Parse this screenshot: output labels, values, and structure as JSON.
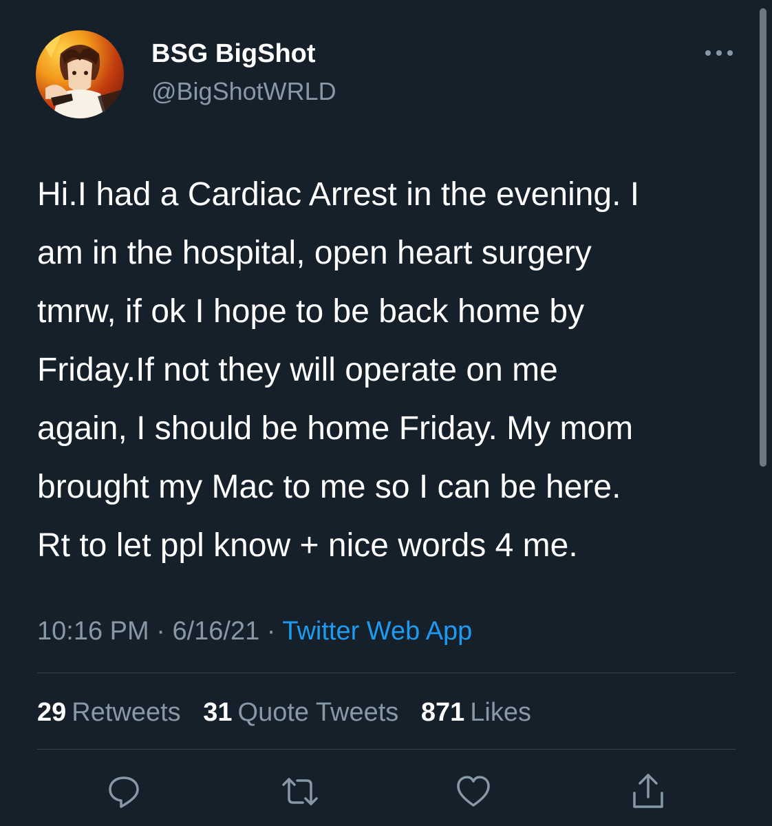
{
  "author": {
    "display_name": "BSG BigShot",
    "handle": "@BigShotWRLD",
    "avatar_icon": "anime-avatar-icon"
  },
  "more_icon": "more-horizontal-icon",
  "tweet": {
    "lines": [
      "Hi.I had a Cardiac Arrest in the evening. I",
      "am in the hospital, open heart surgery",
      "tmrw, if ok I hope to be back home by",
      "Friday.If not they will operate on me",
      "again, I should be home Friday. My mom",
      "brought my Mac to me so I can be here.",
      "Rt to let ppl know + nice words 4 me."
    ]
  },
  "meta": {
    "time": "10:16 PM",
    "separator": "·",
    "date": "6/16/21",
    "source": "Twitter Web App"
  },
  "stats": {
    "retweets": {
      "count": "29",
      "label": "Retweets"
    },
    "quotes": {
      "count": "31",
      "label": "Quote Tweets"
    },
    "likes": {
      "count": "871",
      "label": "Likes"
    }
  },
  "actions": [
    {
      "name": "reply",
      "icon": "reply-icon"
    },
    {
      "name": "retweet",
      "icon": "retweet-icon"
    },
    {
      "name": "like",
      "icon": "heart-icon"
    },
    {
      "name": "share",
      "icon": "share-icon"
    }
  ],
  "colors": {
    "background": "#15202b",
    "secondary_text": "#8899a6",
    "link": "#1d9bf0",
    "divider": "#38444d"
  }
}
